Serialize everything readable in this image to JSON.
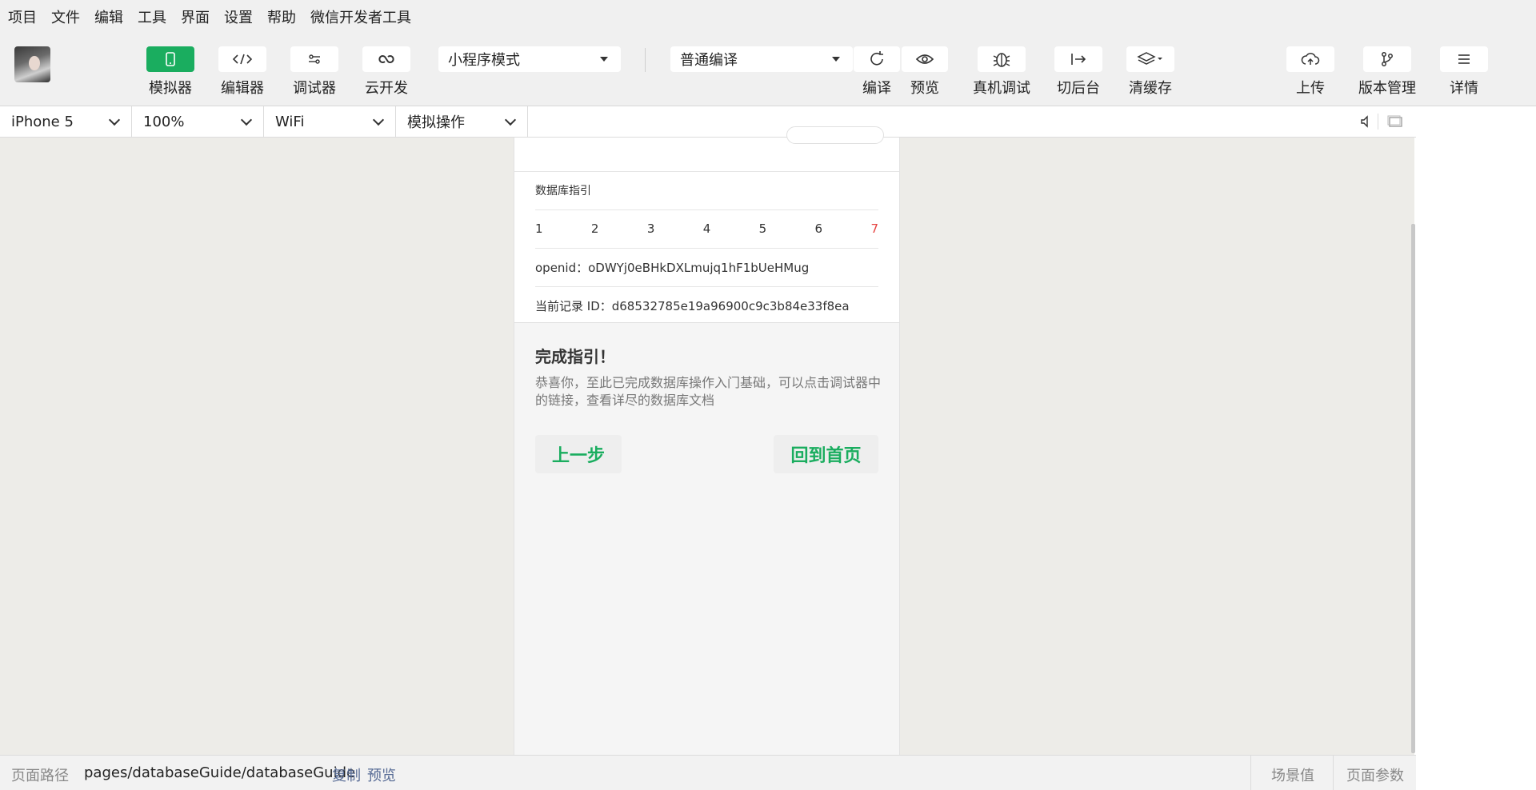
{
  "menu": [
    "项目",
    "文件",
    "编辑",
    "工具",
    "界面",
    "设置",
    "帮助",
    "微信开发者工具"
  ],
  "toolbar": {
    "simulator": "模拟器",
    "editor": "编辑器",
    "debugger": "调试器",
    "cloud": "云开发",
    "mode_select": "小程序模式",
    "compile_select": "普通编译",
    "compile": "编译",
    "preview": "预览",
    "remote_debug": "真机调试",
    "background": "切后台",
    "clear_cache": "清缓存",
    "upload": "上传",
    "version": "版本管理",
    "details": "详情",
    "accent": "#1aad5f"
  },
  "device": {
    "model": "iPhone 5",
    "zoom": "100%",
    "network": "WiFi",
    "operation": "模拟操作"
  },
  "page": {
    "guide_label": "数据库指引",
    "steps": [
      "1",
      "2",
      "3",
      "4",
      "5",
      "6",
      "7"
    ],
    "current_step": "7",
    "openid": "openid：oDWYj0eBHkDXLmujq1hF1bUeHMug",
    "record_id": "当前记录 ID：d68532785e19a96900c9c3b84e33f8ea",
    "done_title": "完成指引！",
    "done_text": "恭喜你，至此已完成数据库操作入门基础，可以点击调试器中的链接，查看详尽的数据库文档",
    "prev_button": "上一步",
    "home_button": "回到首页"
  },
  "status": {
    "path_label": "页面路径",
    "path": "pages/databaseGuide/databaseGuide",
    "copy": "复制",
    "preview": "预览",
    "scene": "场景值",
    "params": "页面参数"
  }
}
